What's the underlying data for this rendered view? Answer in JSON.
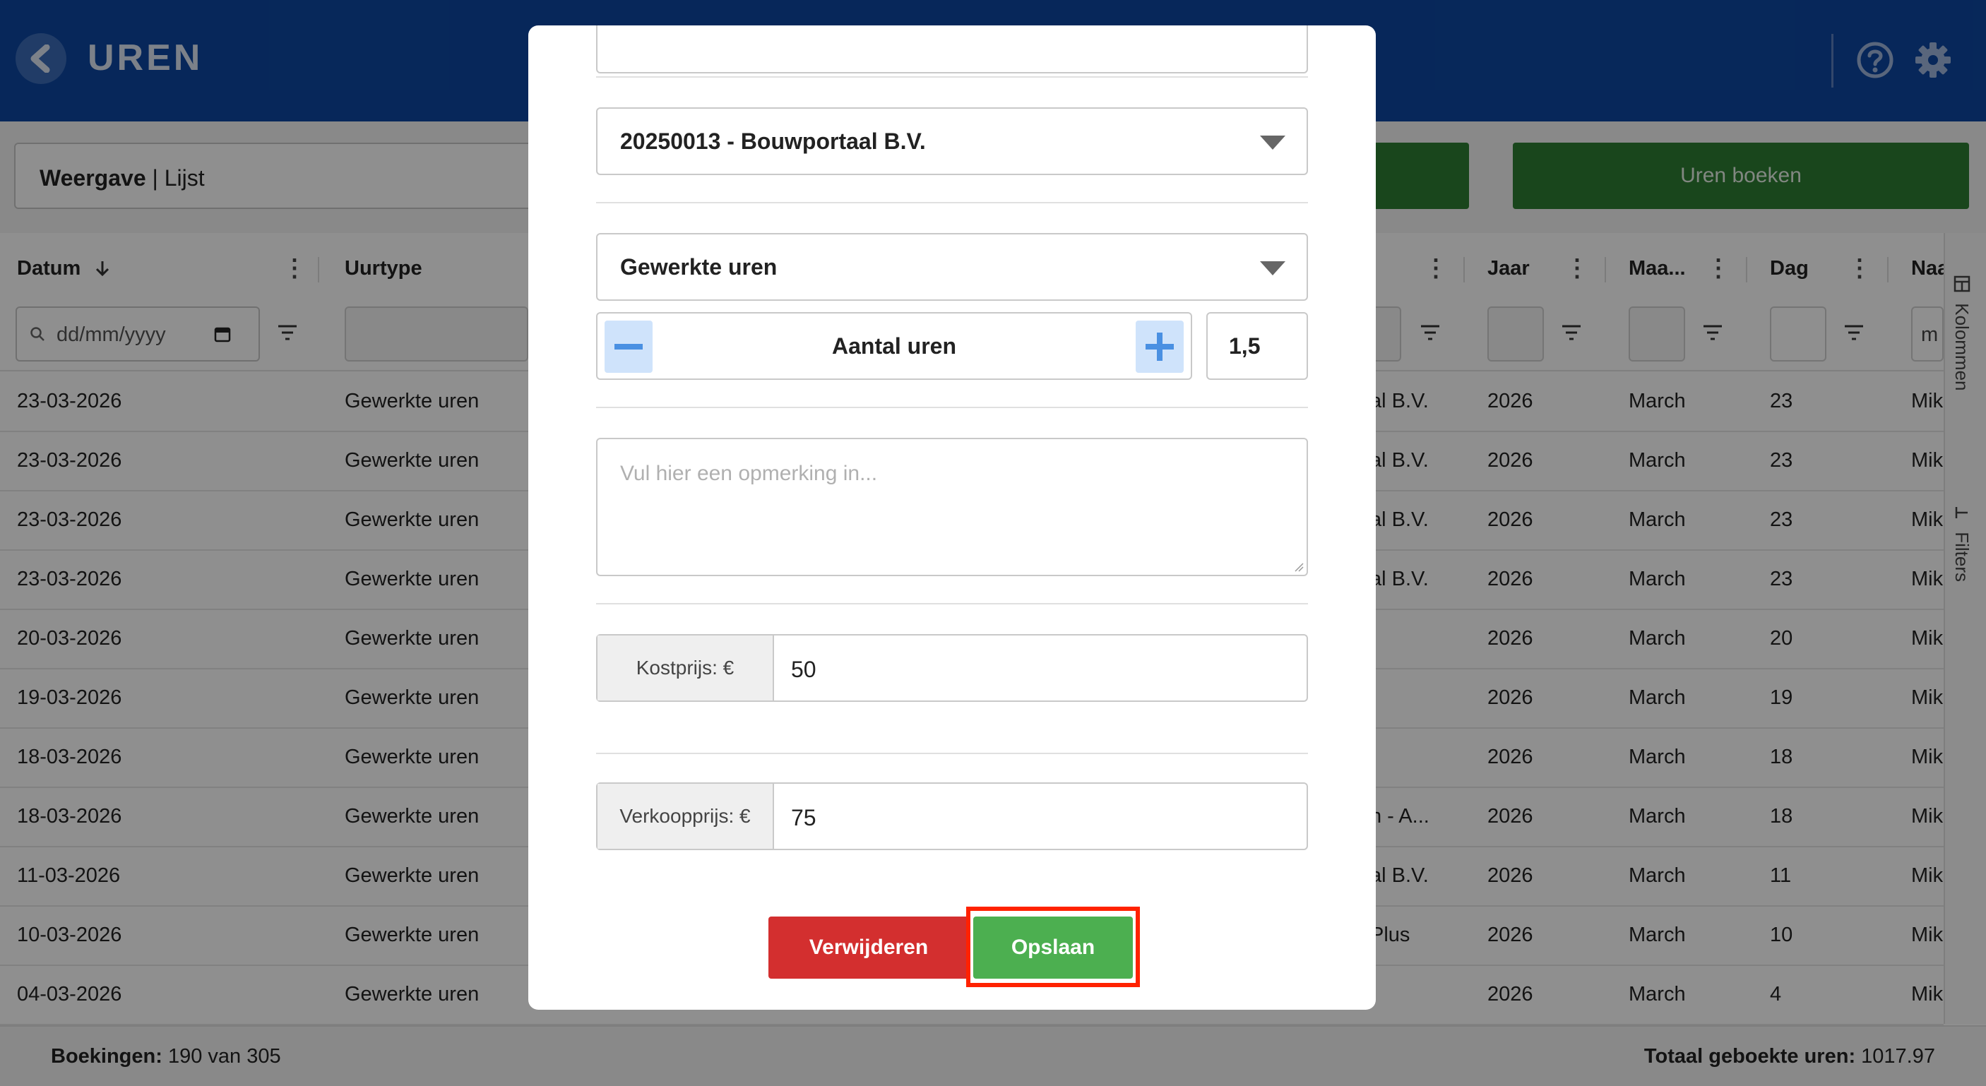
{
  "header": {
    "title": "UREN"
  },
  "toolbar": {
    "view_label": "Weergave",
    "view_value": "Lijst",
    "book_button": "Uren boeken"
  },
  "table": {
    "columns": [
      "Datum",
      "Uurtype",
      "Jaar",
      "Maa...",
      "Dag",
      "Naa"
    ],
    "date_placeholder": "dd/mm/yyyy",
    "partial_filter_value": "m",
    "rows": [
      {
        "datum": "23-03-2026",
        "uurtype": "Gewerkte uren",
        "project": "al B.V.",
        "jaar": "2026",
        "maand": "March",
        "dag": "23",
        "naam": "Mik"
      },
      {
        "datum": "23-03-2026",
        "uurtype": "Gewerkte uren",
        "project": "al B.V.",
        "jaar": "2026",
        "maand": "March",
        "dag": "23",
        "naam": "Mik"
      },
      {
        "datum": "23-03-2026",
        "uurtype": "Gewerkte uren",
        "project": "al B.V.",
        "jaar": "2026",
        "maand": "March",
        "dag": "23",
        "naam": "Mik"
      },
      {
        "datum": "23-03-2026",
        "uurtype": "Gewerkte uren",
        "project": "al B.V.",
        "jaar": "2026",
        "maand": "March",
        "dag": "23",
        "naam": "Mik"
      },
      {
        "datum": "20-03-2026",
        "uurtype": "Gewerkte uren",
        "project": "",
        "jaar": "2026",
        "maand": "March",
        "dag": "20",
        "naam": "Mik"
      },
      {
        "datum": "19-03-2026",
        "uurtype": "Gewerkte uren",
        "project": "",
        "jaar": "2026",
        "maand": "March",
        "dag": "19",
        "naam": "Mik"
      },
      {
        "datum": "18-03-2026",
        "uurtype": "Gewerkte uren",
        "project": "",
        "jaar": "2026",
        "maand": "March",
        "dag": "18",
        "naam": "Mik"
      },
      {
        "datum": "18-03-2026",
        "uurtype": "Gewerkte uren",
        "project": "n - A...",
        "jaar": "2026",
        "maand": "March",
        "dag": "18",
        "naam": "Mik"
      },
      {
        "datum": "11-03-2026",
        "uurtype": "Gewerkte uren",
        "project": "al B.V.",
        "jaar": "2026",
        "maand": "March",
        "dag": "11",
        "naam": "Mik"
      },
      {
        "datum": "10-03-2026",
        "uurtype": "Gewerkte uren",
        "project": "Plus",
        "jaar": "2026",
        "maand": "March",
        "dag": "10",
        "naam": "Mik"
      },
      {
        "datum": "04-03-2026",
        "uurtype": "Gewerkte uren",
        "project": "",
        "jaar": "2026",
        "maand": "March",
        "dag": "4",
        "naam": "Mik"
      }
    ]
  },
  "side_panel": {
    "columns_tab": "Kolommen",
    "filters_tab": "Filters"
  },
  "footer": {
    "bookings_label": "Boekingen:",
    "bookings_value": "190 van 305",
    "total_label": "Totaal geboekte uren:",
    "total_value": "1017.97"
  },
  "modal": {
    "project_select": "20250013 - Bouwportaal B.V.",
    "hour_type_select": "Gewerkte uren",
    "stepper_label": "Aantal uren",
    "quantity": "1,5",
    "remark_placeholder": "Vul hier een opmerking in...",
    "cost_label": "Kostprijs: €",
    "cost_value": "50",
    "sale_label": "Verkoopprijs: €",
    "sale_value": "75",
    "delete_button": "Verwijderen",
    "save_button": "Opslaan"
  },
  "colors": {
    "header": "#0d47a1",
    "primary_green": "#2e7d32",
    "save_green": "#4caf50",
    "delete_red": "#d32f2f",
    "highlight": "#ff2200"
  }
}
